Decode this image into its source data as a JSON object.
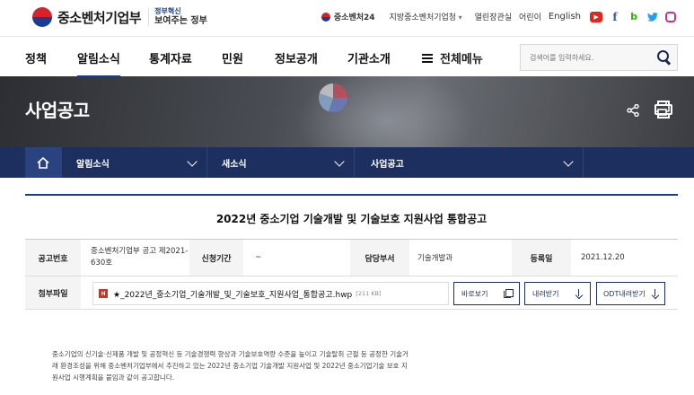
{
  "header": {
    "logo_text": "중소벤처기업부",
    "logo_sub_small": "정부혁신",
    "logo_sub_main": "보여주는 정부",
    "sme24": "중소벤처24",
    "region": "지방중소벤처기업청",
    "kids_link": "열린장관실",
    "child_link": "어린이",
    "english": "English",
    "sns": {
      "youtube": "▶",
      "facebook": "f",
      "blog": "b",
      "twitter": "🐦"
    }
  },
  "gnb": {
    "items": [
      "정책",
      "알림소식",
      "통계자료",
      "민원",
      "정보공개",
      "기관소개"
    ],
    "all_menu": "전체메뉴",
    "search_placeholder": "검색어를 입력하세요."
  },
  "hero": {
    "title": "사업공고"
  },
  "location": {
    "level1": "알림소식",
    "level2": "새소식",
    "level3": "사업공고"
  },
  "article": {
    "title": "2022년 중소기업 기술개발 및 기술보호 지원사업 통합공고",
    "meta": {
      "notice_no_label": "공고번호",
      "notice_no_value": "중소벤처기업부 공고 제2021-630호",
      "period_label": "신청기간",
      "period_value": "~",
      "dept_label": "담당부서",
      "dept_value": "기술개발과",
      "date_label": "등록일",
      "date_value": "2021.12.20",
      "attach_label": "첨부파일"
    },
    "file": {
      "type": "HWP",
      "name": "★_2022년_중소기업_기술개발_및_기술보호_지원사업_통합공고.hwp",
      "size": "[211 KB]",
      "view_label": "바로보기",
      "download_label": "내려받기",
      "odt_label": "ODT내려받기"
    },
    "body": "중소기업의 신기술·신제품 개발 및 공정혁신 등 기술경쟁력 향상과 기술보호역량 수준을 높이고 기술탈취 근절 등 공정한 기술거래 환경조성을 위해 중소벤처기업부에서 추진하고 있는 2022년 중소기업 기술개발 지원사업 및 2022년 중소기업기술 보호 지원사업 시행계획을 붙임과 같이 공고합니다."
  }
}
